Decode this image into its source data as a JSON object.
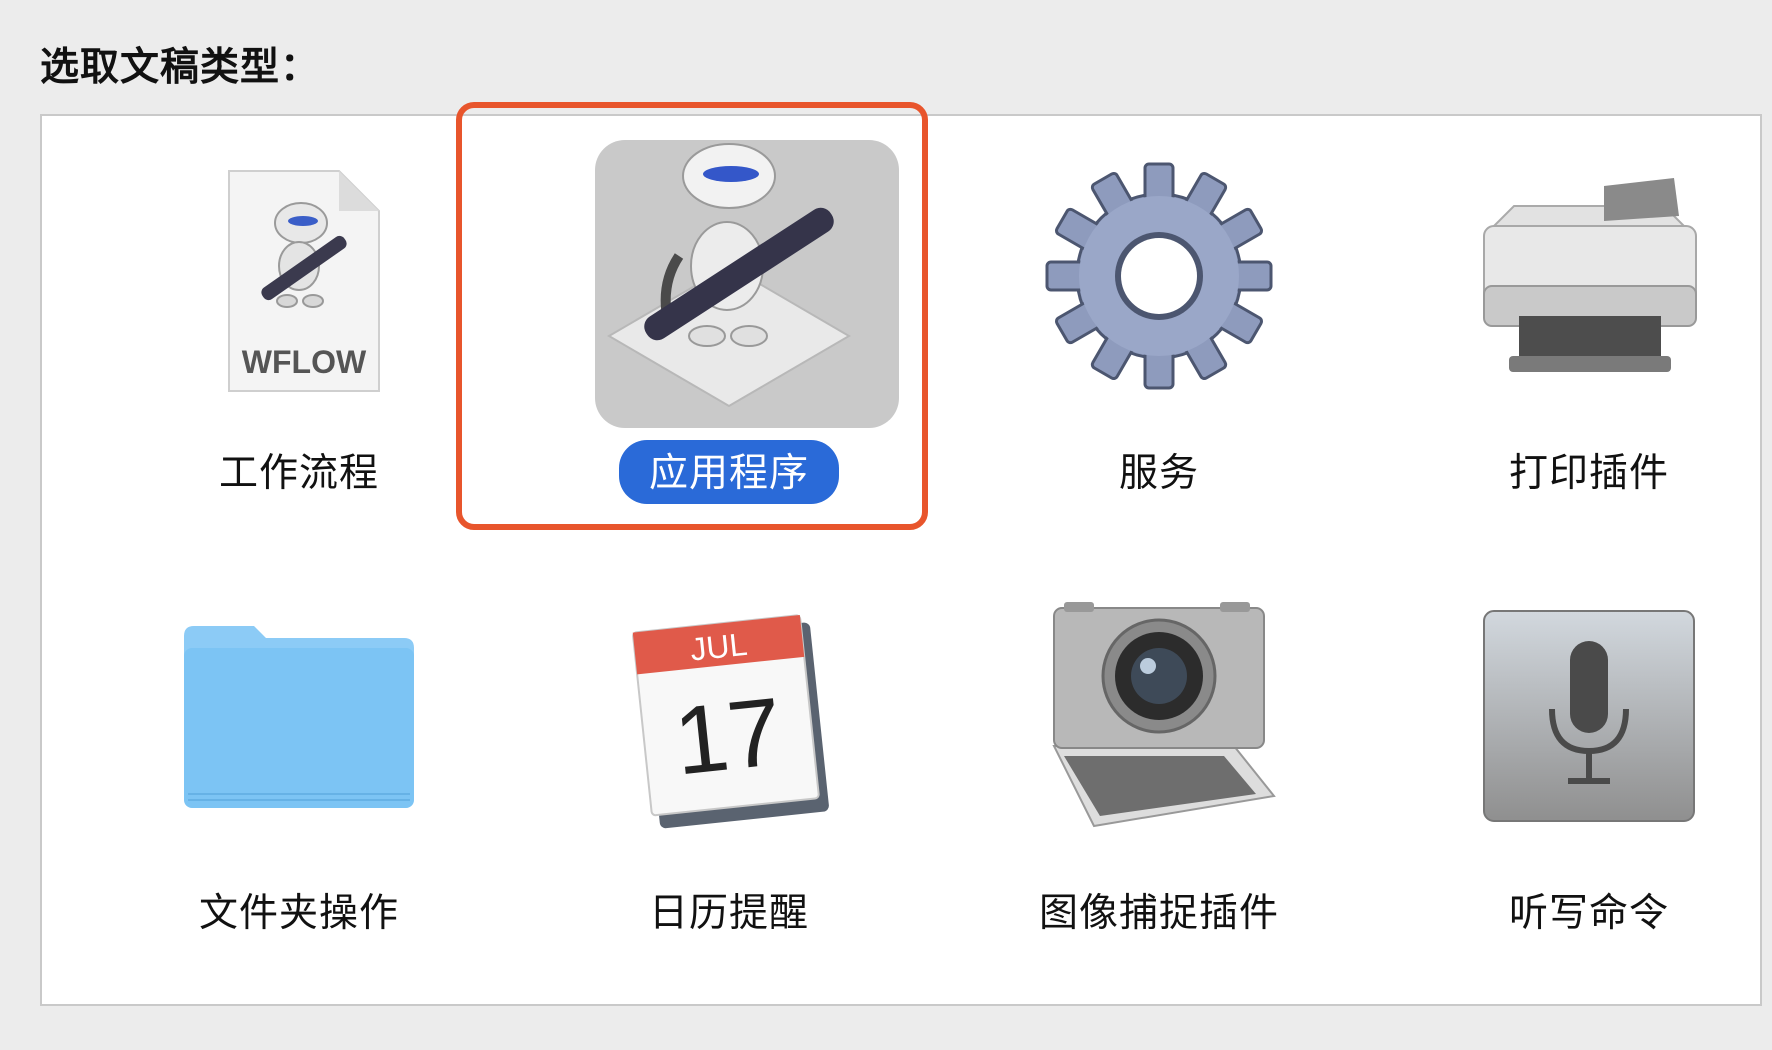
{
  "heading": "选取文稿类型：",
  "items": [
    {
      "label": "工作流程",
      "icon": "workflow-document-icon",
      "file_ext": "WFLOW"
    },
    {
      "label": "应用程序",
      "icon": "automator-robot-icon",
      "selected": true
    },
    {
      "label": "服务",
      "icon": "gear-icon"
    },
    {
      "label": "打印插件",
      "icon": "printer-icon"
    },
    {
      "label": "文件夹操作",
      "icon": "folder-icon"
    },
    {
      "label": "日历提醒",
      "icon": "calendar-icon",
      "month": "JUL",
      "day": "17"
    },
    {
      "label": "图像捕捉插件",
      "icon": "camera-icon"
    },
    {
      "label": "听写命令",
      "icon": "microphone-icon"
    }
  ],
  "colors": {
    "selection": "#2a6ad8",
    "highlight_border": "#e8552c",
    "folder": "#7cc4f4",
    "calendar_header": "#e05a4a"
  }
}
